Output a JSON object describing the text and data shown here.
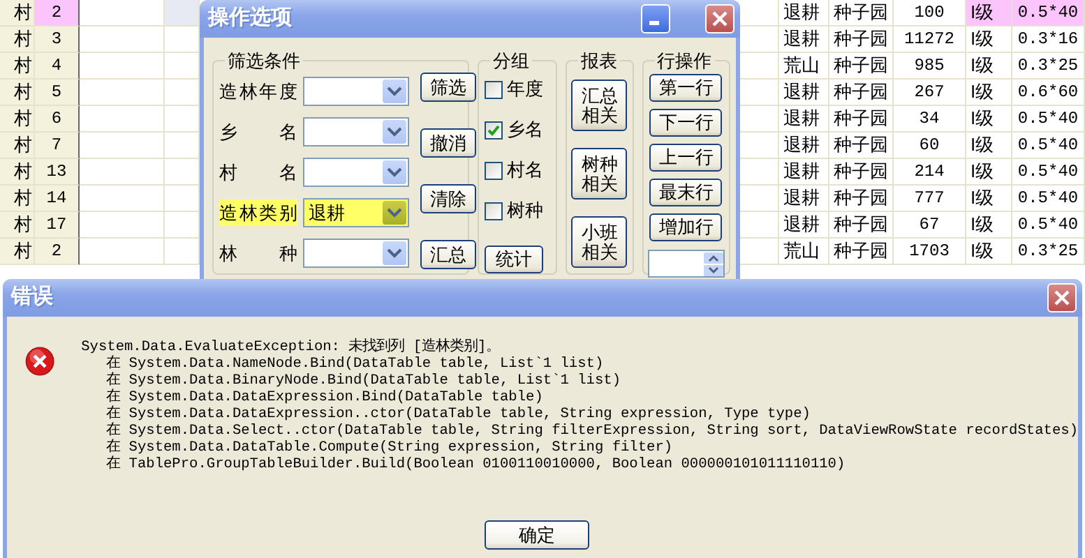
{
  "grid_left": {
    "rows": [
      {
        "cells": [
          "村",
          "2"
        ],
        "selected": true
      },
      {
        "cells": [
          "村",
          "3"
        ],
        "selected": false
      },
      {
        "cells": [
          "村",
          "4"
        ],
        "selected": false
      },
      {
        "cells": [
          "村",
          "5"
        ],
        "selected": false
      },
      {
        "cells": [
          "村",
          "6"
        ],
        "selected": false
      },
      {
        "cells": [
          "村",
          "7"
        ],
        "selected": false
      },
      {
        "cells": [
          "村",
          "13"
        ],
        "selected": false
      },
      {
        "cells": [
          "村",
          "14"
        ],
        "selected": false
      },
      {
        "cells": [
          "村",
          "17"
        ],
        "selected": false
      },
      {
        "cells": [
          "村",
          "2"
        ],
        "selected": false
      }
    ]
  },
  "options_dialog": {
    "title": "操作选项",
    "filter": {
      "title": "筛选条件",
      "fields": [
        {
          "label": "造林年度",
          "highlighted": false
        },
        {
          "label": "乡 名",
          "highlighted": false
        },
        {
          "label": "村 名",
          "highlighted": false
        },
        {
          "label": "造林类别",
          "value": "退耕",
          "highlighted": true
        },
        {
          "label": "林 种",
          "highlighted": false
        }
      ],
      "buttons": [
        "筛选",
        "撤消",
        "清除",
        "汇总"
      ]
    },
    "grouping": {
      "title": "分组",
      "options": [
        {
          "label": "年度",
          "checked": false
        },
        {
          "label": "乡名",
          "checked": true
        },
        {
          "label": "村名",
          "checked": false
        },
        {
          "label": "树种",
          "checked": false
        }
      ],
      "button": "统计"
    },
    "reports": {
      "title": "报表",
      "buttons": [
        "汇总相关",
        "树种相关",
        "小班相关"
      ]
    },
    "row_ops": {
      "title": "行操作",
      "buttons": [
        "第一行",
        "下一行",
        "上一行",
        "最末行",
        "增加行"
      ]
    }
  },
  "grid_right": {
    "rows": [
      {
        "cells": [
          "退耕",
          "种子园",
          "100",
          "I级",
          "0.5*40"
        ],
        "selected": true
      },
      {
        "cells": [
          "退耕",
          "种子园",
          "11272",
          "I级",
          "0.3*16"
        ],
        "selected": false
      },
      {
        "cells": [
          "荒山",
          "种子园",
          "985",
          "I级",
          "0.3*25"
        ],
        "selected": false
      },
      {
        "cells": [
          "退耕",
          "种子园",
          "267",
          "I级",
          "0.6*60"
        ],
        "selected": false
      },
      {
        "cells": [
          "退耕",
          "种子园",
          "34",
          "I级",
          "0.5*40"
        ],
        "selected": false
      },
      {
        "cells": [
          "退耕",
          "种子园",
          "60",
          "I级",
          "0.5*40"
        ],
        "selected": false
      },
      {
        "cells": [
          "退耕",
          "种子园",
          "214",
          "I级",
          "0.5*40"
        ],
        "selected": false
      },
      {
        "cells": [
          "退耕",
          "种子园",
          "777",
          "I级",
          "0.5*40"
        ],
        "selected": false
      },
      {
        "cells": [
          "退耕",
          "种子园",
          "67",
          "I级",
          "0.5*40"
        ],
        "selected": false
      },
      {
        "cells": [
          "荒山",
          "种子园",
          "1703",
          "I级",
          "0.3*25"
        ],
        "selected": false
      }
    ]
  },
  "error_dialog": {
    "title": "错误",
    "message": "System.Data.EvaluateException: 未找到列 [造林类别]。",
    "stack": [
      "在 System.Data.NameNode.Bind(DataTable table, List`1 list)",
      "在 System.Data.BinaryNode.Bind(DataTable table, List`1 list)",
      "在 System.Data.DataExpression.Bind(DataTable table)",
      "在 System.Data.DataExpression..ctor(DataTable table, String expression, Type type)",
      "在 System.Data.Select..ctor(DataTable table, String filterExpression, String sort, DataViewRowState recordStates)",
      "在 System.Data.DataTable.Compute(String expression, String filter)",
      "在 TablePro.GroupTableBuilder.Build(Boolean 0100110010000, Boolean 000000101011110110)"
    ],
    "button": "确定"
  }
}
